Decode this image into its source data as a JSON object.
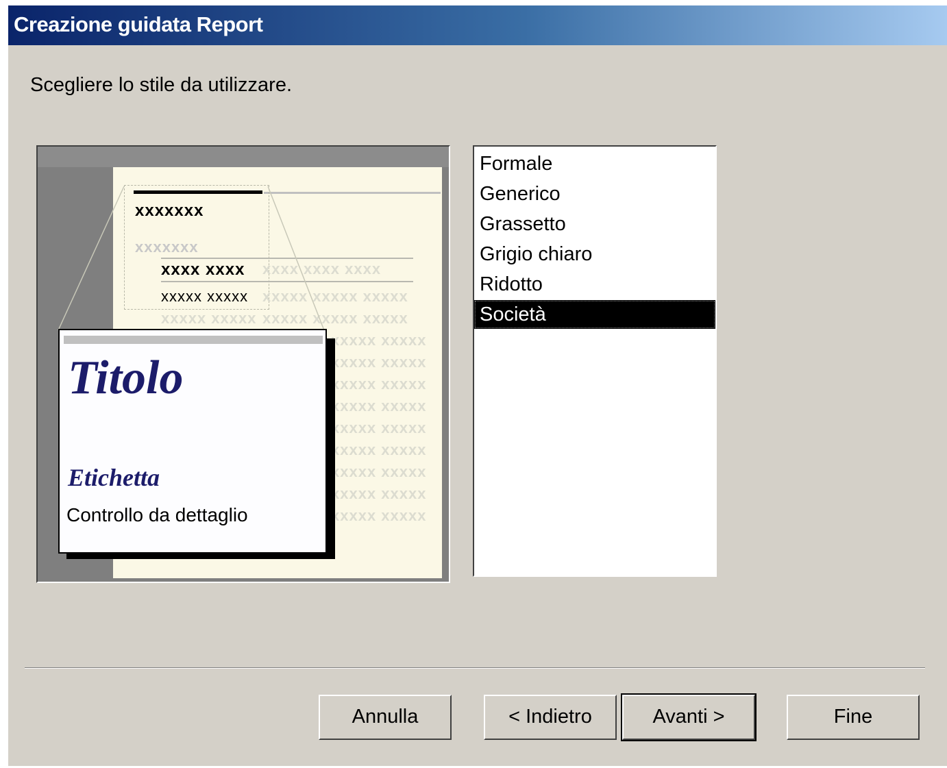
{
  "window": {
    "title": "Creazione guidata Report"
  },
  "prompt": "Scegliere lo stile da utilizzare.",
  "preview": {
    "header_text": "xxxxxxx",
    "faint_header": "xxxxxxx",
    "column_header": "xxxx xxxx",
    "column_header_faint": "xxxx xxxx xxxx",
    "detail_row": "xxxxx xxxxx",
    "detail_row_faint": "xxxxx xxxxx xxxxx",
    "card": {
      "title": "Titolo",
      "label": "Etichetta",
      "control": "Controllo da dettaglio"
    }
  },
  "styles": {
    "items": [
      "Formale",
      "Generico",
      "Grassetto",
      "Grigio chiaro",
      "Ridotto",
      "Società"
    ],
    "selected": "Società"
  },
  "buttons": {
    "cancel": "Annulla",
    "back": "< Indietro",
    "next": "Avanti >",
    "finish": "Fine"
  },
  "colors": {
    "dialog_bg": "#d4d0c8",
    "title_gradient_start": "#0a246a",
    "selection": "#000000",
    "preview_title": "#1c1c6a"
  }
}
